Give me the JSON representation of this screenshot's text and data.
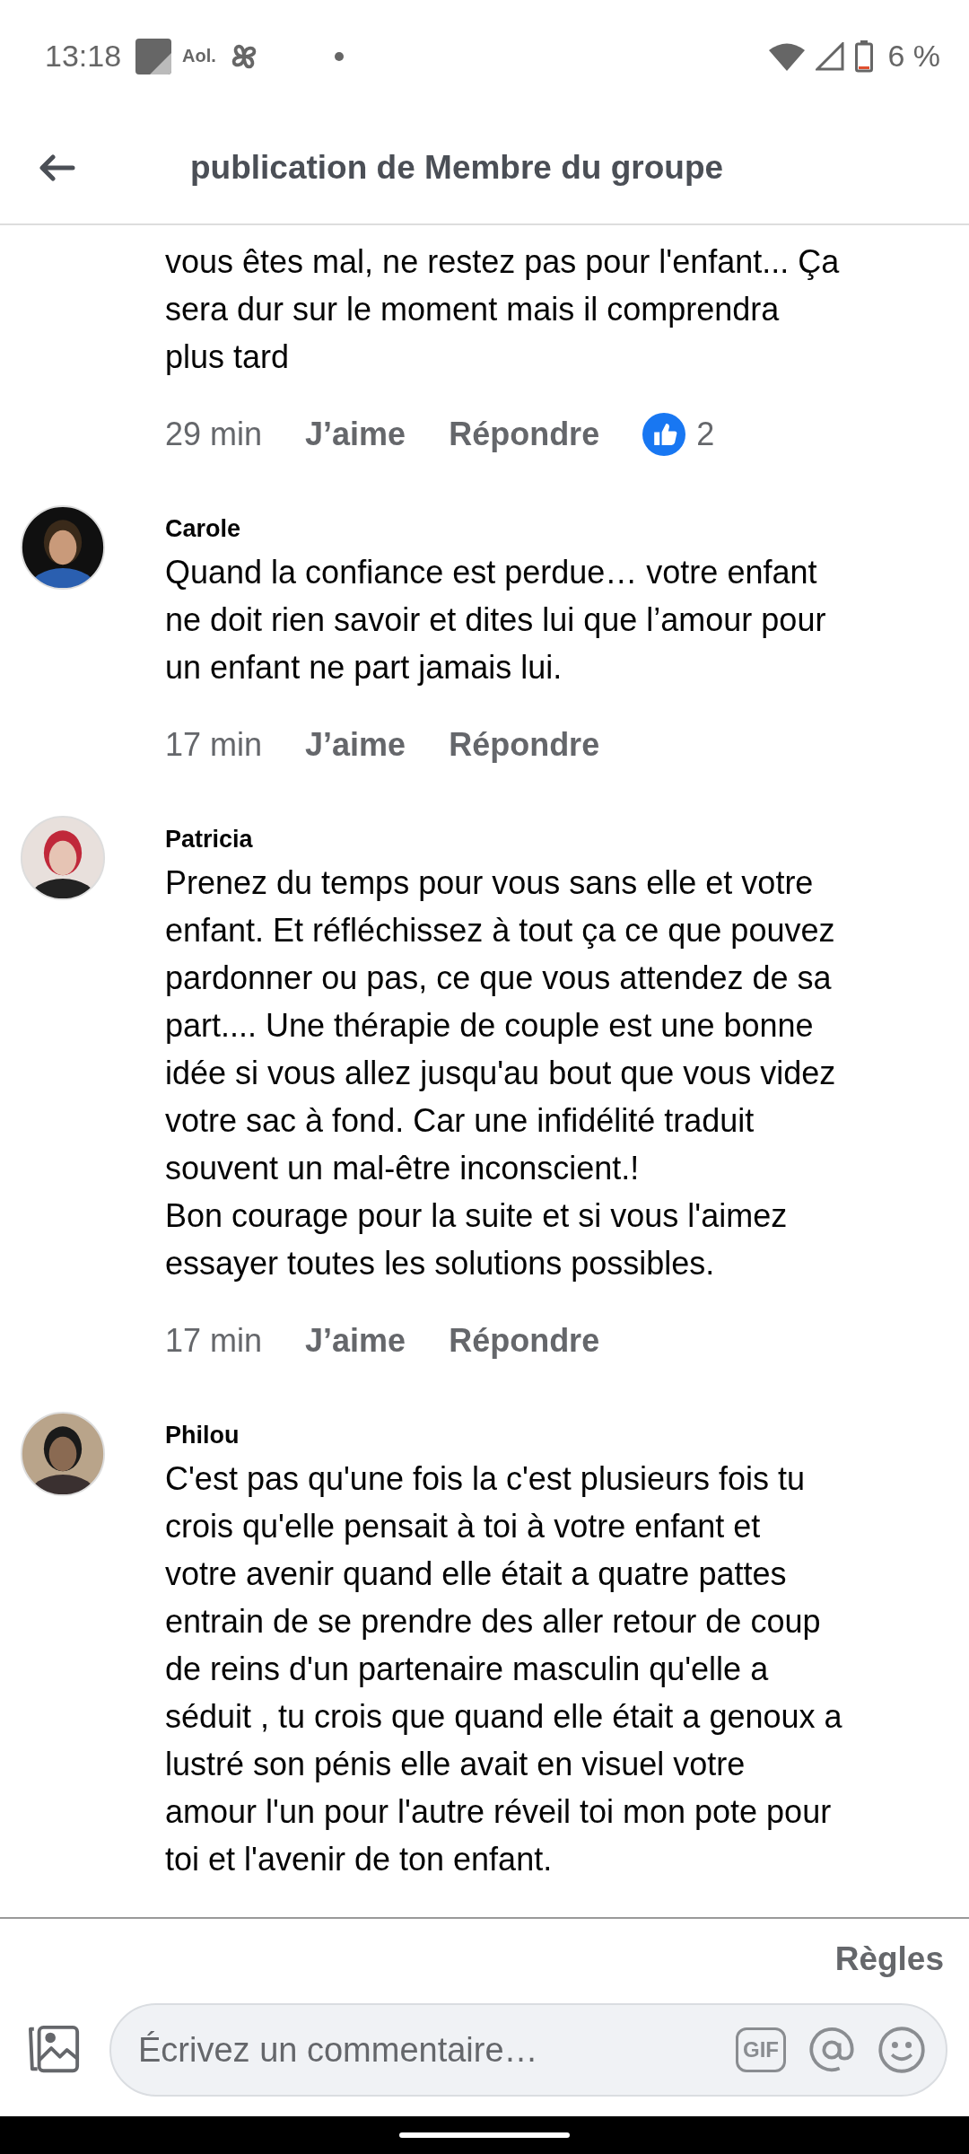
{
  "status_bar": {
    "time": "13:18",
    "app_label": "Aol.",
    "battery": "6 %"
  },
  "header": {
    "title": "publication de Membre du groupe"
  },
  "comments": [
    {
      "lines": [
        "vous êtes mal, ne restez pas pour l'enfant... Ça",
        "sera dur sur le moment mais il comprendra",
        "plus tard"
      ],
      "time": "29 min",
      "like": "J’aime",
      "reply": "Répondre",
      "reactions": "2"
    },
    {
      "name": "Carole",
      "lines": [
        "Quand la confiance est perdue… votre enfant",
        "ne doit rien savoir et dites lui que l’amour pour",
        "un enfant ne part jamais lui."
      ],
      "time": "17 min",
      "like": "J’aime",
      "reply": "Répondre"
    },
    {
      "name": "Patricia",
      "lines": [
        "Prenez du temps pour vous sans elle et votre",
        "enfant. Et réfléchissez à tout ça ce que pouvez",
        "pardonner ou pas, ce que vous attendez de sa",
        "part.... Une thérapie de couple est une bonne",
        "idée si vous allez jusqu'au bout que vous videz",
        "votre sac à fond. Car une infidélité traduit",
        "souvent un mal-être inconscient.!",
        "Bon courage pour la suite et si vous l'aimez",
        "essayer toutes les solutions possibles."
      ],
      "time": "17 min",
      "like": "J’aime",
      "reply": "Répondre"
    },
    {
      "name": "Philou",
      "lines": [
        "C'est pas qu'une fois la c'est plusieurs fois tu",
        "crois qu'elle pensait à toi  à votre enfant et",
        "votre avenir quand elle était a quatre pattes",
        "entrain de se prendre des aller retour de coup",
        "de reins d'un partenaire masculin qu'elle a",
        "séduit , tu crois que quand elle était a genoux a",
        "lustré son pénis elle avait en visuel votre",
        "amour l'un pour l'autre réveil toi mon pote pour",
        "toi et l'avenir de ton enfant."
      ]
    }
  ],
  "footer": {
    "rules": "Règles",
    "placeholder": "Écrivez un commentaire…",
    "gif": "GIF"
  }
}
